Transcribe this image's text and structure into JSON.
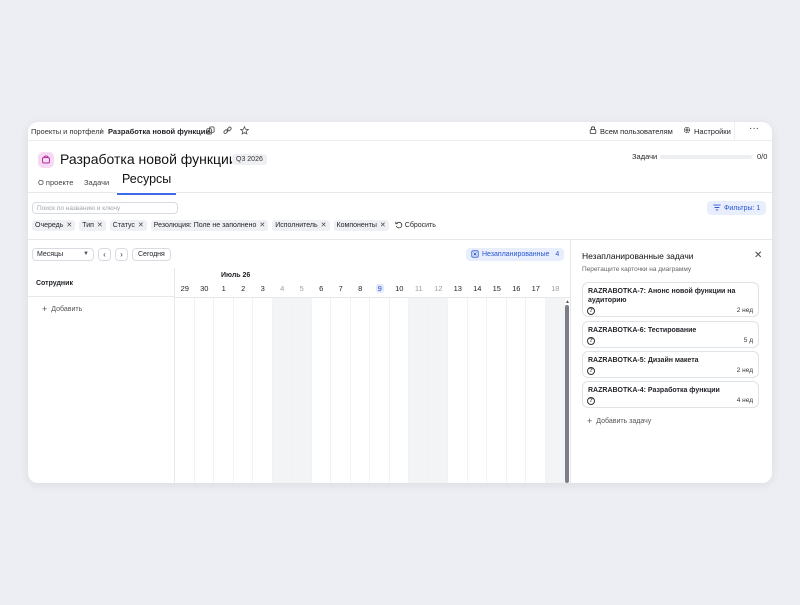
{
  "topbar": {
    "breadcrumb_parent": "Проекты и портфели",
    "breadcrumb_sep": "/",
    "breadcrumb_current": "Разработка новой функции",
    "users_label": "Всем пользователям",
    "settings_label": "Настройки",
    "more_label": "···"
  },
  "header": {
    "title": "Разработка новой функции",
    "quarter": "Q3 2026",
    "tasks_label": "Задачи",
    "tasks_count": "0/0",
    "tasks_progress": 0
  },
  "tabs": [
    {
      "label": "О проекте"
    },
    {
      "label": "Задачи"
    },
    {
      "label": "Ресурсы",
      "active": true
    }
  ],
  "search": {
    "placeholder": "Поиск по названию и ключу"
  },
  "filters": {
    "button_label": "Фильтры: 1",
    "chips": [
      "Очередь",
      "Тип",
      "Статус",
      "Резолюция: Поле не заполнено",
      "Исполнитель",
      "Компоненты"
    ],
    "reset_label": "Сбросить"
  },
  "calendar": {
    "scale": "Месяцы",
    "today_label": "Сегодня",
    "unplanned_label": "Незапланированные",
    "unplanned_count": "4",
    "month_label": "Июль 26",
    "days": [
      "29",
      "30",
      "1",
      "2",
      "3",
      "4",
      "5",
      "6",
      "7",
      "8",
      "9",
      "10",
      "11",
      "12",
      "13",
      "14",
      "15",
      "16",
      "17",
      "18"
    ],
    "weekend_indices": [
      5,
      6,
      12,
      13,
      19
    ],
    "today_index": 10
  },
  "gantt": {
    "employee_header": "Сотрудник",
    "add_label": "Добавить"
  },
  "panel": {
    "title": "Незапланированные задачи",
    "subtitle": "Перетащите карточки на диаграмму",
    "cards": [
      {
        "title": "RAZRABOTKA-7: Анонс новой функции на аудиторию",
        "duration": "2 нед"
      },
      {
        "title": "RAZRABOTKA-6: Тестирование",
        "duration": "5 д"
      },
      {
        "title": "RAZRABOTKA-5: Дизайн макета",
        "duration": "2 нед"
      },
      {
        "title": "RAZRABOTKA-4: Разработка функции",
        "duration": "4 нед"
      }
    ],
    "add_task_label": "Добавить задачу"
  },
  "colors": {
    "accent": "#2b55d6",
    "accent_bg": "#e8eefc",
    "project_icon_bg": "#f6d9f2"
  }
}
